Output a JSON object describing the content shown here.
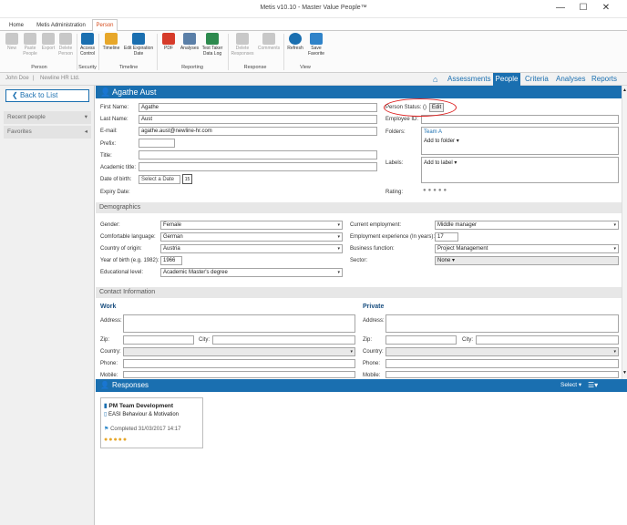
{
  "window": {
    "title": "Metis v10.10 - Master Value People™",
    "minimize": "—",
    "maximize": "☐",
    "close": "✕"
  },
  "tabs": [
    "Home",
    "Metis Administration",
    "Person"
  ],
  "ribbon": {
    "buttons": [
      "New",
      "Paste People",
      "Export",
      "Delete Person",
      "Access Control",
      "Timeline",
      "Edit Expiration Date",
      "PDF",
      "Analyses",
      "Test Taker Data Log",
      "Delete Responses",
      "Comments",
      "Refresh",
      "Save Favorite"
    ],
    "groups": [
      "Person",
      "Security",
      "Timeline",
      "Reporting",
      "Response",
      "View"
    ]
  },
  "user": {
    "name": "John Doe",
    "company": "Newline HR Ltd."
  },
  "nav": [
    "Assessments",
    "People",
    "Criteria",
    "Analyses",
    "Reports"
  ],
  "left": {
    "back": "Back to List",
    "recent": "Recent people",
    "favorites": "Favorites"
  },
  "person": {
    "name": "Agathe Aust",
    "first_name_label": "First Name:",
    "first_name": "Agathe",
    "last_name_label": "Last Name:",
    "last_name": "Aust",
    "email_label": "E-mail:",
    "email": "agathe.aust@newline-hr.com",
    "prefix_label": "Prefix:",
    "title_label": "Title:",
    "academic_label": "Academic title:",
    "dob_label": "Date of birth:",
    "dob_placeholder": "Select a Date",
    "calendar_day": "15",
    "expiry_label": "Expiry Date:",
    "status_label": "Person Status:",
    "status_value": "()",
    "edit": "Edit",
    "employee_label": "Employee ID:",
    "folders_label": "Folders:",
    "folder_value": "Team A",
    "add_folder": "Add to folder",
    "labels_label": "Labels:",
    "add_label": "Add to label",
    "rating_label": "Rating:"
  },
  "demographics": {
    "section": "Demographics",
    "gender_label": "Gender:",
    "gender": "Female",
    "language_label": "Comfortable language:",
    "language": "German",
    "country_label": "Country of origin:",
    "country": "Austria",
    "year_label": "Year of birth (e.g. 1982):",
    "year": "1966",
    "edu_label": "Educational level:",
    "edu": "Academic Master's degree",
    "employment_label": "Current employment:",
    "employment": "Middle manager",
    "experience_label": "Employment experience (In years):",
    "experience": "17",
    "function_label": "Business function:",
    "function": "Project Management",
    "sector_label": "Sector:",
    "sector": "None"
  },
  "contact": {
    "section": "Contact Information",
    "work": "Work",
    "private": "Private",
    "address": "Address:",
    "zip": "Zip:",
    "city": "City:",
    "country": "Country:",
    "phone": "Phone:",
    "mobile": "Mobile:"
  },
  "responses": {
    "title": "Responses",
    "select": "Select",
    "card_title": "PM Team Development",
    "card_test": "EASI Behaviour & Motivation",
    "card_completed": "Completed 31/03/2017 14:17"
  },
  "colors": {
    "accent": "#1a6fb0",
    "highlight": "#d64b1c",
    "circle": "#dd2222"
  }
}
